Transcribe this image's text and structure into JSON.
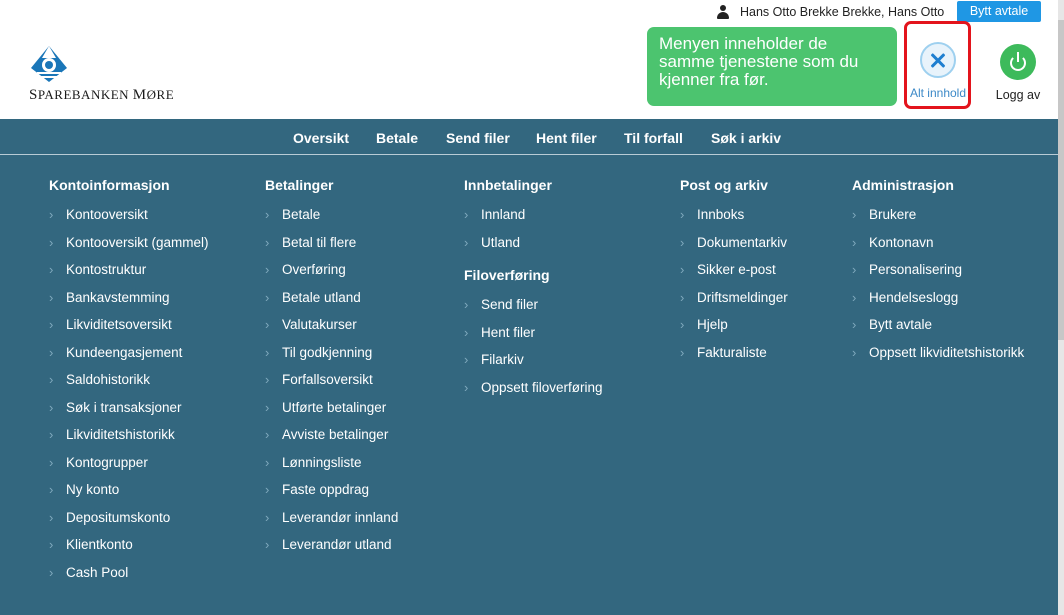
{
  "header": {
    "user_name": "Hans Otto Brekke Brekke, Hans Otto",
    "switch_agreement": "Bytt avtale",
    "logo_text_first": "S",
    "logo_text_rest": "PAREBANKEN",
    "logo_text_m": "M",
    "logo_text_end": "ØRE",
    "tooltip": "Menyen inneholder de samme tjenestene som du kjenner fra før.",
    "alt_label": "Alt innhold",
    "logout_label": "Logg av"
  },
  "nav": [
    "Oversikt",
    "Betale",
    "Send filer",
    "Hent filer",
    "Til forfall",
    "Søk i arkiv"
  ],
  "menu": {
    "kontoinformasjon": {
      "title": "Kontoinformasjon",
      "items": [
        "Kontooversikt",
        "Kontooversikt (gammel)",
        "Kontostruktur",
        "Bankavstemming",
        "Likviditetsoversikt",
        "Kundeengasjement",
        "Saldohistorikk",
        "Søk i transaksjoner",
        "Likviditetshistorikk",
        "Kontogrupper",
        "Ny konto",
        "Depositumskonto",
        "Klientkonto",
        "Cash Pool"
      ]
    },
    "betalinger": {
      "title": "Betalinger",
      "items": [
        "Betale",
        "Betal til flere",
        "Overføring",
        "Betale utland",
        "Valutakurser",
        "Til godkjenning",
        "Forfallsoversikt",
        "Utførte betalinger",
        "Avviste betalinger",
        "Lønningsliste",
        "Faste oppdrag",
        "Leverandør innland",
        "Leverandør utland"
      ]
    },
    "innbetalinger": {
      "title": "Innbetalinger",
      "items": [
        "Innland",
        "Utland"
      ]
    },
    "filoverforing": {
      "title": "Filoverføring",
      "items": [
        "Send filer",
        "Hent filer",
        "Filarkiv",
        "Oppsett filoverføring"
      ]
    },
    "post": {
      "title": "Post og arkiv",
      "items": [
        "Innboks",
        "Dokumentarkiv",
        "Sikker e-post",
        "Driftsmeldinger",
        "Hjelp",
        "Fakturaliste"
      ]
    },
    "admin": {
      "title": "Administrasjon",
      "items": [
        "Brukere",
        "Kontonavn",
        "Personalisering",
        "Hendelseslogg",
        "Bytt avtale",
        "Oppsett likviditetshistorikk"
      ]
    }
  },
  "colors": {
    "menu_bg": "#33677f",
    "tooltip_bg": "#4cc46f",
    "button_blue": "#1f97e4",
    "highlight_red": "#e3141c",
    "logout_green": "#3dba5b"
  }
}
